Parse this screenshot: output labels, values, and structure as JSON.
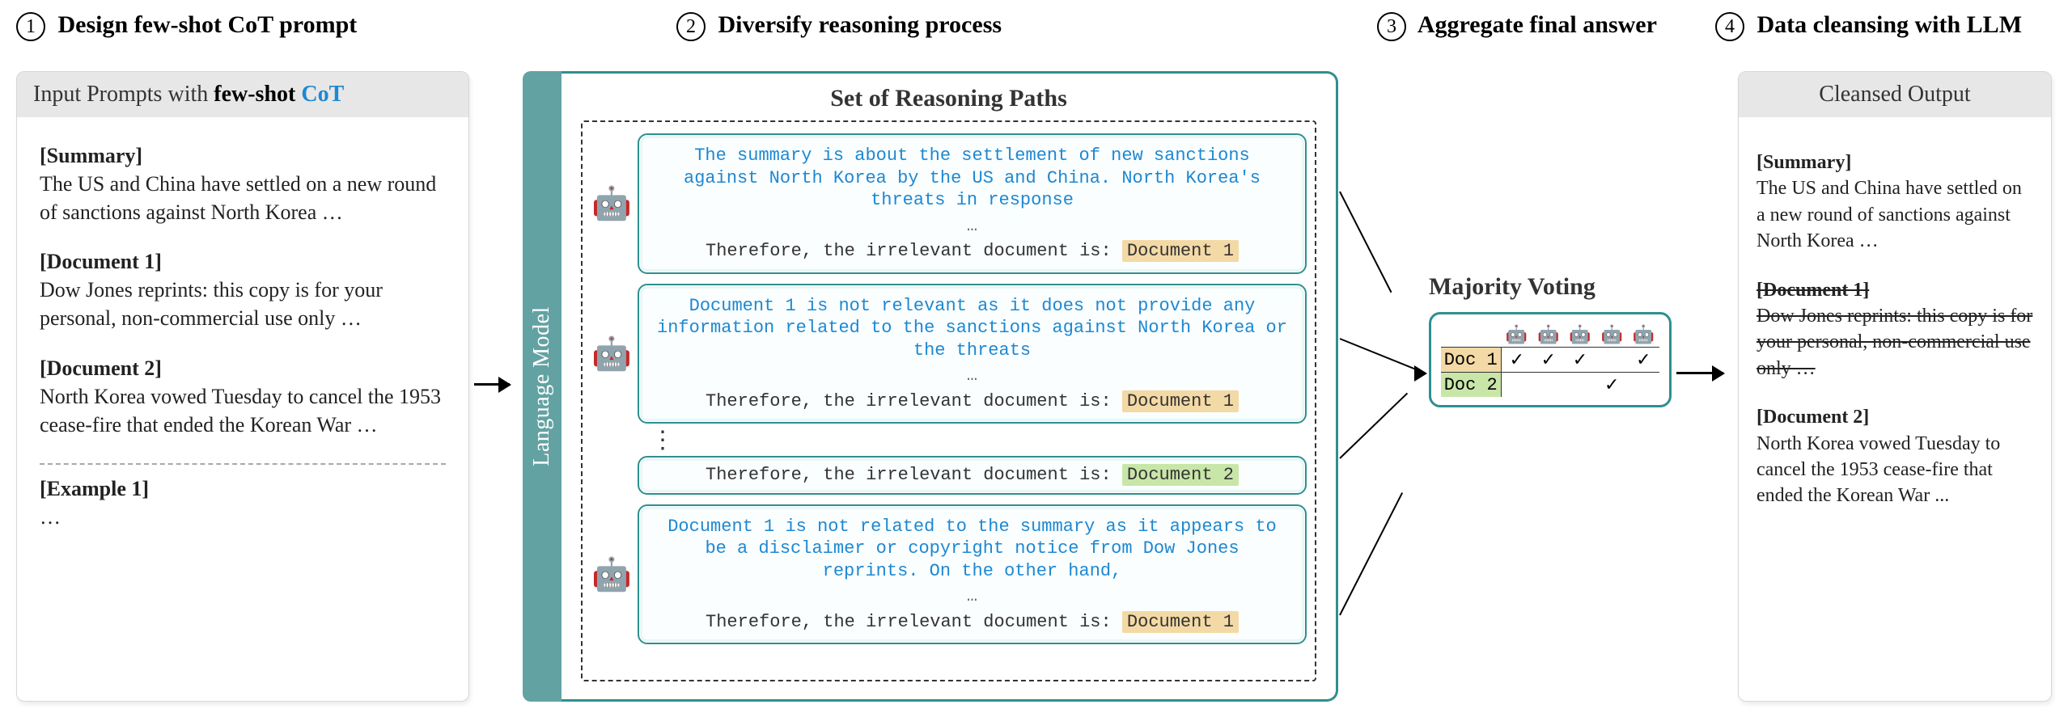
{
  "steps": {
    "s1": "Design few-shot CoT prompt",
    "s2": "Diversify reasoning process",
    "s3": "Aggregate final answer",
    "s4": "Data cleansing with LLM"
  },
  "nums": {
    "n1": "1",
    "n2": "2",
    "n3": "3",
    "n4": "4"
  },
  "input": {
    "title_prefix": "Input Prompts",
    "title_with": " with ",
    "title_fs": "few-shot ",
    "title_cot": "CoT",
    "summary_h": "[Summary]",
    "summary_t": "The US and China have settled on a new round of sanctions against North Korea …",
    "doc1_h": "[Document 1]",
    "doc1_t": "Dow Jones reprints: this copy is for your personal, non-commercial use only …",
    "doc2_h": "[Document 2]",
    "doc2_t": "North Korea vowed Tuesday to cancel the 1953 cease-fire that ended the Korean War …",
    "ex_h": "[Example 1]",
    "ex_t": "…"
  },
  "lm_label": "Language Model",
  "paths_title": "Set of Reasoning Paths",
  "paths": [
    {
      "reason": "The summary is about the settlement of new sanctions against North Korea by the US and China. North Korea's threats in response",
      "ell": "…",
      "concl": "Therefore, the irrelevant document is: ",
      "ans": "Document 1",
      "ans_class": "hl-tan"
    },
    {
      "reason": "Document 1 is not relevant as it does not provide any information related to the sanctions against North Korea or the threats",
      "ell": "…",
      "concl": "Therefore, the irrelevant document is: ",
      "ans": "Document 1",
      "ans_class": "hl-tan"
    },
    {
      "reason": "",
      "ell": "",
      "concl": "Therefore, the irrelevant document is: ",
      "ans": "Document 2",
      "ans_class": "hl-green"
    },
    {
      "reason": "Document 1 is not related to the summary as it appears to be a disclaimer or copyright notice from Dow Jones reprints. On the other hand,",
      "ell": "…",
      "concl": "Therefore, the irrelevant document is: ",
      "ans": "Document 1",
      "ans_class": "hl-tan"
    }
  ],
  "mv": {
    "title": "Majority Voting",
    "robot": "🤖",
    "check": "✓",
    "rows": [
      {
        "label": "Doc 1",
        "votes": [
          true,
          true,
          true,
          false,
          true
        ]
      },
      {
        "label": "Doc 2",
        "votes": [
          false,
          false,
          false,
          true,
          false
        ]
      }
    ]
  },
  "output": {
    "title": "Cleansed Output",
    "summary_h": "[Summary]",
    "summary_t": "The US and China have settled on a new round of sanctions against North Korea …",
    "doc1_h": "[Document 1]",
    "doc1_t": "Dow Jones reprints: this copy is for your personal, non-commercial use only …",
    "doc2_h": "[Document 2]",
    "doc2_t": "North Korea vowed Tuesday to cancel the 1953 cease-fire that ended the Korean War ..."
  }
}
